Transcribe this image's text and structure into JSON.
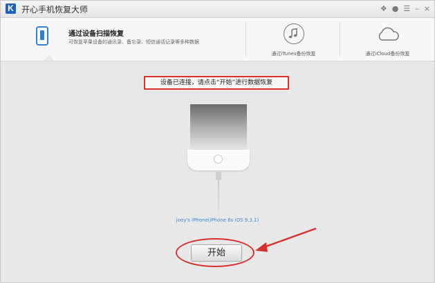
{
  "app": {
    "title": "开心手机恢复大师",
    "logo_letter": "K"
  },
  "window_controls": [
    {
      "name": "wechat-icon",
      "glyph": "❖"
    },
    {
      "name": "qq-icon",
      "glyph": "●"
    },
    {
      "name": "menu-icon",
      "glyph": "☰"
    },
    {
      "name": "minimize-icon",
      "glyph": "–"
    },
    {
      "name": "close-icon",
      "glyph": "×"
    }
  ],
  "tabs": [
    {
      "title": "通过设备扫描恢复",
      "subtitle": "可恢复苹果设备的通讯录、备忘录、短信通话记录等多种数据",
      "icon": "phone-icon",
      "active": true
    },
    {
      "label": "通过iTunes备份恢复",
      "icon": "music-note-icon",
      "active": false
    },
    {
      "label": "通过iCloud备份恢复",
      "icon": "cloud-icon",
      "active": false
    }
  ],
  "main": {
    "notice": "设备已连接，请点击“开始”进行数据恢复",
    "device_info": "joey's iPhone(iPhone 6s iOS 9.3.1)",
    "start_label": "开始"
  },
  "colors": {
    "accent": "#2e7fd6",
    "annotation": "#d8302a",
    "link": "#3a8ad6"
  }
}
